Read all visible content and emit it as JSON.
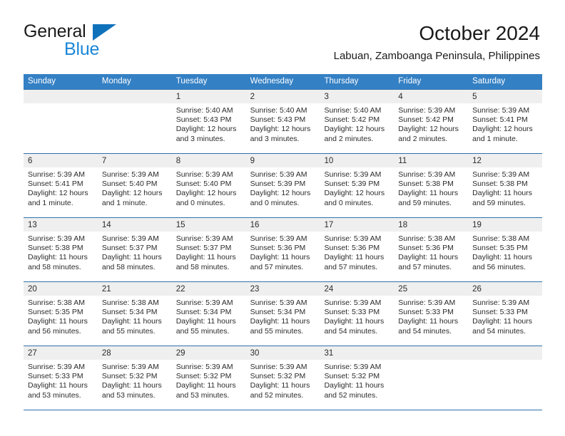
{
  "brand": {
    "name_top": "General",
    "name_bottom": "Blue",
    "triangle_color": "#1071bb",
    "blue_text_color": "#1b86d6"
  },
  "header": {
    "title": "October 2024",
    "subtitle": "Labuan, Zamboanga Peninsula, Philippines"
  },
  "theme": {
    "header_bar_color": "#3480c4",
    "header_bar_text": "#ffffff",
    "day_band_color": "#efefef",
    "row_rule_color": "#2e72ad",
    "text_color": "#2b2b2b"
  },
  "weekdays": [
    "Sunday",
    "Monday",
    "Tuesday",
    "Wednesday",
    "Thursday",
    "Friday",
    "Saturday"
  ],
  "weeks": [
    [
      {
        "day": "",
        "lines": []
      },
      {
        "day": "",
        "lines": []
      },
      {
        "day": "1",
        "lines": [
          "Sunrise: 5:40 AM",
          "Sunset: 5:43 PM",
          "Daylight: 12 hours",
          "and 3 minutes."
        ]
      },
      {
        "day": "2",
        "lines": [
          "Sunrise: 5:40 AM",
          "Sunset: 5:43 PM",
          "Daylight: 12 hours",
          "and 3 minutes."
        ]
      },
      {
        "day": "3",
        "lines": [
          "Sunrise: 5:40 AM",
          "Sunset: 5:42 PM",
          "Daylight: 12 hours",
          "and 2 minutes."
        ]
      },
      {
        "day": "4",
        "lines": [
          "Sunrise: 5:39 AM",
          "Sunset: 5:42 PM",
          "Daylight: 12 hours",
          "and 2 minutes."
        ]
      },
      {
        "day": "5",
        "lines": [
          "Sunrise: 5:39 AM",
          "Sunset: 5:41 PM",
          "Daylight: 12 hours",
          "and 1 minute."
        ]
      }
    ],
    [
      {
        "day": "6",
        "lines": [
          "Sunrise: 5:39 AM",
          "Sunset: 5:41 PM",
          "Daylight: 12 hours",
          "and 1 minute."
        ]
      },
      {
        "day": "7",
        "lines": [
          "Sunrise: 5:39 AM",
          "Sunset: 5:40 PM",
          "Daylight: 12 hours",
          "and 1 minute."
        ]
      },
      {
        "day": "8",
        "lines": [
          "Sunrise: 5:39 AM",
          "Sunset: 5:40 PM",
          "Daylight: 12 hours",
          "and 0 minutes."
        ]
      },
      {
        "day": "9",
        "lines": [
          "Sunrise: 5:39 AM",
          "Sunset: 5:39 PM",
          "Daylight: 12 hours",
          "and 0 minutes."
        ]
      },
      {
        "day": "10",
        "lines": [
          "Sunrise: 5:39 AM",
          "Sunset: 5:39 PM",
          "Daylight: 12 hours",
          "and 0 minutes."
        ]
      },
      {
        "day": "11",
        "lines": [
          "Sunrise: 5:39 AM",
          "Sunset: 5:38 PM",
          "Daylight: 11 hours",
          "and 59 minutes."
        ]
      },
      {
        "day": "12",
        "lines": [
          "Sunrise: 5:39 AM",
          "Sunset: 5:38 PM",
          "Daylight: 11 hours",
          "and 59 minutes."
        ]
      }
    ],
    [
      {
        "day": "13",
        "lines": [
          "Sunrise: 5:39 AM",
          "Sunset: 5:38 PM",
          "Daylight: 11 hours",
          "and 58 minutes."
        ]
      },
      {
        "day": "14",
        "lines": [
          "Sunrise: 5:39 AM",
          "Sunset: 5:37 PM",
          "Daylight: 11 hours",
          "and 58 minutes."
        ]
      },
      {
        "day": "15",
        "lines": [
          "Sunrise: 5:39 AM",
          "Sunset: 5:37 PM",
          "Daylight: 11 hours",
          "and 58 minutes."
        ]
      },
      {
        "day": "16",
        "lines": [
          "Sunrise: 5:39 AM",
          "Sunset: 5:36 PM",
          "Daylight: 11 hours",
          "and 57 minutes."
        ]
      },
      {
        "day": "17",
        "lines": [
          "Sunrise: 5:39 AM",
          "Sunset: 5:36 PM",
          "Daylight: 11 hours",
          "and 57 minutes."
        ]
      },
      {
        "day": "18",
        "lines": [
          "Sunrise: 5:38 AM",
          "Sunset: 5:36 PM",
          "Daylight: 11 hours",
          "and 57 minutes."
        ]
      },
      {
        "day": "19",
        "lines": [
          "Sunrise: 5:38 AM",
          "Sunset: 5:35 PM",
          "Daylight: 11 hours",
          "and 56 minutes."
        ]
      }
    ],
    [
      {
        "day": "20",
        "lines": [
          "Sunrise: 5:38 AM",
          "Sunset: 5:35 PM",
          "Daylight: 11 hours",
          "and 56 minutes."
        ]
      },
      {
        "day": "21",
        "lines": [
          "Sunrise: 5:38 AM",
          "Sunset: 5:34 PM",
          "Daylight: 11 hours",
          "and 55 minutes."
        ]
      },
      {
        "day": "22",
        "lines": [
          "Sunrise: 5:39 AM",
          "Sunset: 5:34 PM",
          "Daylight: 11 hours",
          "and 55 minutes."
        ]
      },
      {
        "day": "23",
        "lines": [
          "Sunrise: 5:39 AM",
          "Sunset: 5:34 PM",
          "Daylight: 11 hours",
          "and 55 minutes."
        ]
      },
      {
        "day": "24",
        "lines": [
          "Sunrise: 5:39 AM",
          "Sunset: 5:33 PM",
          "Daylight: 11 hours",
          "and 54 minutes."
        ]
      },
      {
        "day": "25",
        "lines": [
          "Sunrise: 5:39 AM",
          "Sunset: 5:33 PM",
          "Daylight: 11 hours",
          "and 54 minutes."
        ]
      },
      {
        "day": "26",
        "lines": [
          "Sunrise: 5:39 AM",
          "Sunset: 5:33 PM",
          "Daylight: 11 hours",
          "and 54 minutes."
        ]
      }
    ],
    [
      {
        "day": "27",
        "lines": [
          "Sunrise: 5:39 AM",
          "Sunset: 5:33 PM",
          "Daylight: 11 hours",
          "and 53 minutes."
        ]
      },
      {
        "day": "28",
        "lines": [
          "Sunrise: 5:39 AM",
          "Sunset: 5:32 PM",
          "Daylight: 11 hours",
          "and 53 minutes."
        ]
      },
      {
        "day": "29",
        "lines": [
          "Sunrise: 5:39 AM",
          "Sunset: 5:32 PM",
          "Daylight: 11 hours",
          "and 53 minutes."
        ]
      },
      {
        "day": "30",
        "lines": [
          "Sunrise: 5:39 AM",
          "Sunset: 5:32 PM",
          "Daylight: 11 hours",
          "and 52 minutes."
        ]
      },
      {
        "day": "31",
        "lines": [
          "Sunrise: 5:39 AM",
          "Sunset: 5:32 PM",
          "Daylight: 11 hours",
          "and 52 minutes."
        ]
      },
      {
        "day": "",
        "lines": []
      },
      {
        "day": "",
        "lines": []
      }
    ]
  ]
}
